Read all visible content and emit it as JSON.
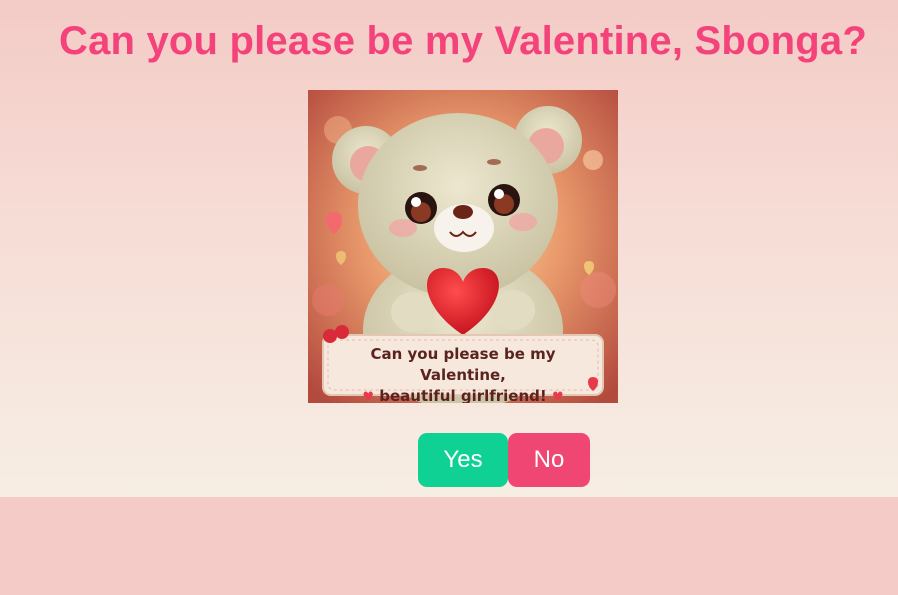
{
  "title": "Can you please be my Valentine, Sbonga?",
  "image": {
    "caption_line1": "Can you please be my Valentine,",
    "caption_line2": "beautiful girlfriend!"
  },
  "buttons": {
    "yes_label": "Yes",
    "no_label": "No"
  },
  "colors": {
    "title": "#f4437a",
    "yes_button": "#10d194",
    "no_button": "#f04673",
    "background": "#f4cbc6"
  }
}
